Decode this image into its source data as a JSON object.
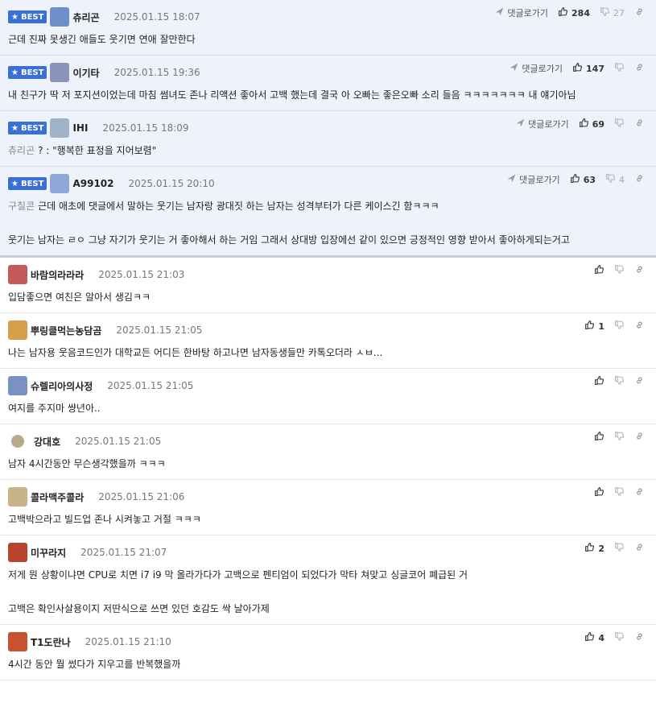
{
  "best_label": "BEST",
  "reply_label": "댓글로가기",
  "comments": [
    {
      "best": true,
      "nick": "츄리곤",
      "date": "2025.01.15 18:07",
      "likes": "284",
      "dislikes": "27",
      "quote": "",
      "lines": [
        "근데 진짜 못생긴 애들도 웃기면 연애 잘만한다"
      ]
    },
    {
      "best": true,
      "nick": "이기타",
      "date": "2025.01.15 19:36",
      "likes": "147",
      "dislikes": "",
      "quote": "",
      "lines": [
        "내 친구가 딱 저 포지션이었는데 마침 썸녀도 존나 리액션 좋아서 고백 했는데 결국 아 오빠는 좋은오빠 소리 들음 ㅋㅋㅋㅋㅋㅋㅋ 내 얘기아님"
      ]
    },
    {
      "best": true,
      "nick": "IHI",
      "date": "2025.01.15 18:09",
      "likes": "69",
      "dislikes": "",
      "quote": "츄리곤",
      "lines": [
        "? : \"행복한 표정을 지어보렴\""
      ]
    },
    {
      "best": true,
      "nick": "A99102",
      "date": "2025.01.15 20:10",
      "likes": "63",
      "dislikes": "4",
      "quote": "구칠콘",
      "lines": [
        "근데 애초에 댓글에서 말하는 웃기는 남자랑 광대짓 하는 남자는 성격부터가 다른 케이스긴 함ㅋㅋㅋ",
        "웃기는 남자는 ㄹㅇ 그냥 자기가 웃기는 거 좋아해서 하는 거임 그래서 상대방 입장에선 같이 있으면 긍정적인 영향 받아서 좋아하게되는거고"
      ]
    },
    {
      "best": false,
      "nick": "바람의라라라",
      "date": "2025.01.15 21:03",
      "likes": "",
      "dislikes": "",
      "quote": "",
      "lines": [
        "입담좋으면 여친은 알아서 생김ㅋㅋ"
      ]
    },
    {
      "best": false,
      "nick": "뿌링클먹는농담곰",
      "date": "2025.01.15 21:05",
      "likes": "1",
      "dislikes": "",
      "quote": "",
      "lines": [
        "나는 남자용 웃음코드인가 대학교든 어디든 한바탕 하고나면 남자동생들만 카톡오더라 ㅅㅂ..."
      ]
    },
    {
      "best": false,
      "nick": "슈렐리아의사정",
      "date": "2025.01.15 21:05",
      "likes": "",
      "dislikes": "",
      "quote": "",
      "lines": [
        "여지를 주지마 썅년아.."
      ]
    },
    {
      "best": false,
      "nick": "강대호",
      "date": "2025.01.15 21:05",
      "likes": "",
      "dislikes": "",
      "quote": "",
      "lines": [
        "남자 4시간동안 무슨생각했을까 ㅋㅋㅋ"
      ]
    },
    {
      "best": false,
      "nick": "콜라맥주콜라",
      "date": "2025.01.15 21:06",
      "likes": "",
      "dislikes": "",
      "quote": "",
      "lines": [
        "고백박으라고 빌드업 존나 시켜놓고 거절 ㅋㅋㅋ"
      ]
    },
    {
      "best": false,
      "nick": "미꾸라지",
      "date": "2025.01.15 21:07",
      "likes": "2",
      "dislikes": "",
      "quote": "",
      "lines": [
        "저게 뭔 상황이냐면 CPU로 치면 i7 i9 막 올라가다가 고백으로 펜티엄이 되었다가 막타 쳐맞고 싱글코어 폐급된 거",
        "고백은 확인사살용이지 저딴식으로 쓰면 있던 호감도 싹 날아가제"
      ]
    },
    {
      "best": false,
      "nick": "T1도란나",
      "date": "2025.01.15 21:10",
      "likes": "4",
      "dislikes": "",
      "quote": "",
      "lines": [
        "4시간 동안 뭘 썼다가 지우고를 반복했을까"
      ]
    }
  ],
  "colors": {
    "best_bg": "#eef2fb",
    "badge": "#3a6fd8"
  },
  "icons": {
    "reply": "send-arrow-icon",
    "like": "thumbs-up-icon",
    "dislike": "thumbs-down-icon",
    "link": "link-icon"
  }
}
